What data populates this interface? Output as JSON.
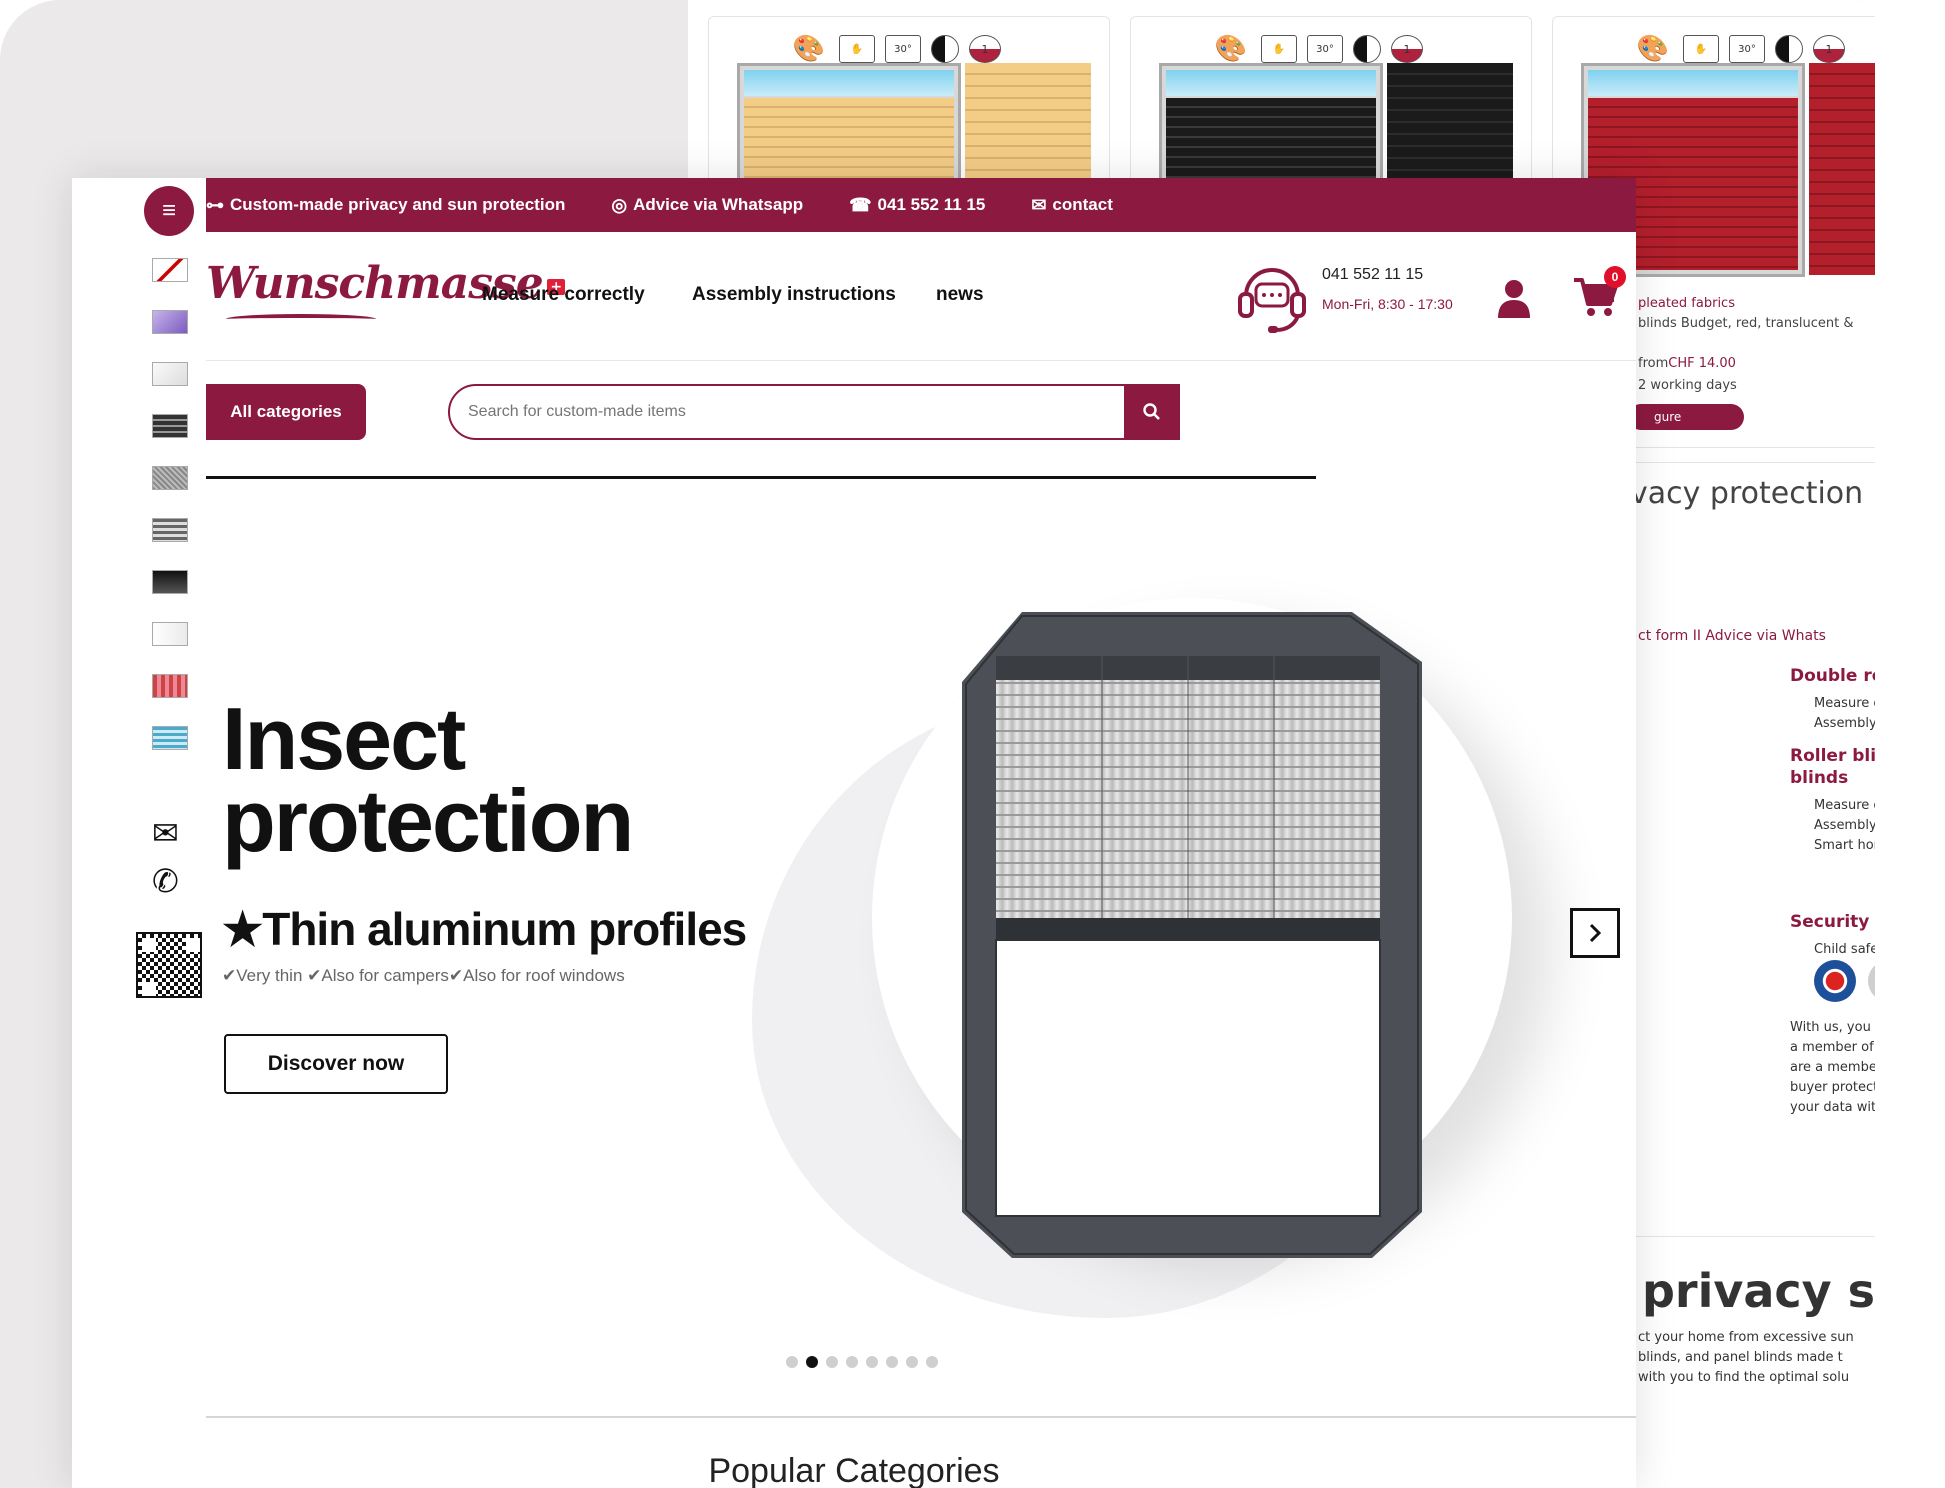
{
  "back": {
    "products": [
      {
        "colors": {
          "c1": "#f3cc86",
          "c2": "#d9b26d"
        },
        "pg": "1"
      },
      {
        "colors": {
          "c1": "#1b1b1b",
          "c2": "#3a3a3a"
        },
        "pg": "1"
      },
      {
        "colors": {
          "c1": "#b41f2c",
          "c2": "#8e1620"
        },
        "pg": "1"
      }
    ],
    "wash_label": "30°",
    "pg_label": "1",
    "card3": {
      "category": "pleated fabrics",
      "desc": "blinds Budget, red, translucent &",
      "price_prefix": "from",
      "price": "CHF  14.00",
      "delivery": "2 working days",
      "button": "gure"
    },
    "heading_privacy": "vacy protection",
    "contact_links": "ct form  II  Advice via Whats",
    "double_roller": "Double rol",
    "measure1": "Measure c",
    "assembly1": "Assembly i",
    "roller_blinds": "Roller blind",
    "roller_blinds2": "blinds",
    "measure2": "Measure c",
    "assembly2": "Assembly i",
    "smart_home": "Smart hom",
    "security": "Security",
    "child_safety": "Child safety",
    "para": [
      "With us, you ca",
      "a member of H",
      "are a member",
      "buyer protectio",
      "your data with"
    ],
    "big_heading": "privacy se",
    "bottom_para": [
      "ct your home from excessive sun",
      "blinds, and panel blinds made t",
      "with you to find the optimal solu"
    ]
  },
  "topbar": {
    "items": [
      {
        "icon": "ruler-icon",
        "label": "Custom-made privacy and sun protection"
      },
      {
        "icon": "whatsapp-icon",
        "label": "Advice via Whatsapp"
      },
      {
        "icon": "phone-icon",
        "label": "041 552 11 15"
      },
      {
        "icon": "contact-icon",
        "label": "contact"
      }
    ]
  },
  "logo": {
    "text": "Wunschmasse",
    "flag": "+"
  },
  "nav": [
    "Measure correctly",
    "Assembly instructions",
    "news"
  ],
  "contact": {
    "phone": "041 552 11 15",
    "hours": "Mon-Fri, 8:30 - 17:30"
  },
  "cart": {
    "count": "0"
  },
  "all_categories": "All categories",
  "search": {
    "placeholder": "Search for custom-made items"
  },
  "hero": {
    "title_line1": "Insect",
    "title_line2": "protection",
    "subtitle": "★Thin aluminum profiles",
    "features": "✔Very thin ✔Also for campers✔Also for roof windows",
    "cta": "Discover now"
  },
  "slider": {
    "count": 8,
    "active": 1
  },
  "section_title": "Popular Categories",
  "colors": {
    "brand": "#8c1a40"
  }
}
